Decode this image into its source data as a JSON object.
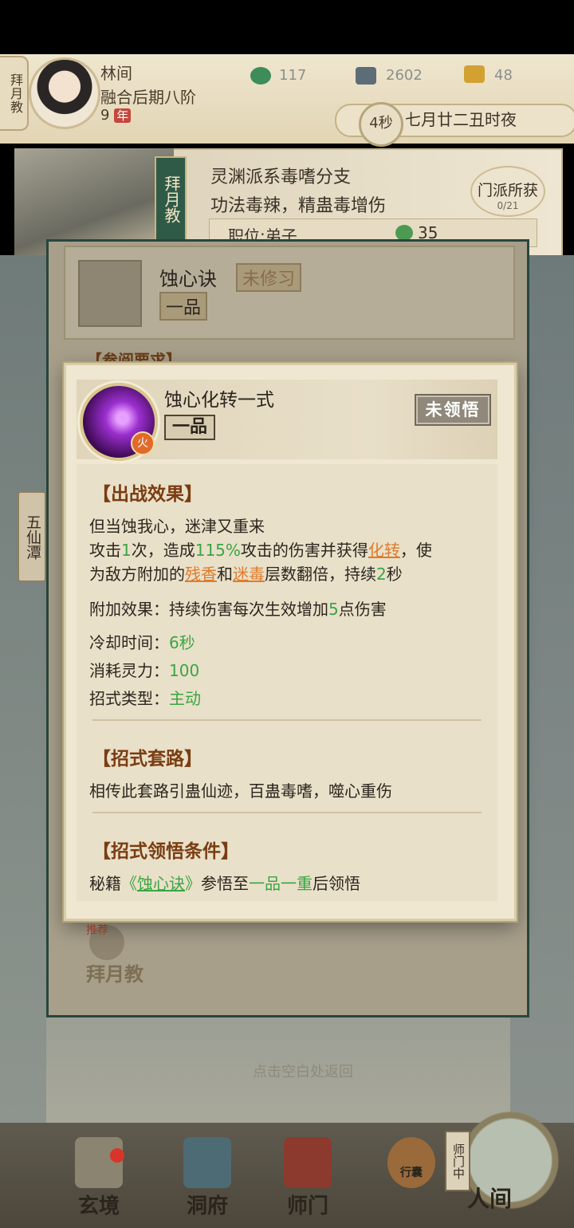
{
  "sect_tab": "拜月教",
  "player": {
    "name": "林间",
    "realm": "融合后期八阶",
    "years_value": "9",
    "years_unit": "年"
  },
  "resources": [
    {
      "icon": "jade-icon",
      "value": "117"
    },
    {
      "icon": "coin-icon",
      "value": "2602"
    },
    {
      "icon": "trophy-icon",
      "value": "48"
    }
  ],
  "time": {
    "countdown": "4秒",
    "label": "七月廿二丑时夜"
  },
  "sect": {
    "flag": "拜月教",
    "line1": "灵渊派系毒嗜分支",
    "line2": "功法毒辣，精蛊毒增伤",
    "position": "职位:弟子",
    "points": "35",
    "menpai_label": "门派所获",
    "menpai_count": "0/21"
  },
  "side_tab": "五仙潭",
  "book": {
    "name": "蚀心诀",
    "status": "未修习",
    "grade": "一品",
    "section_partial": "【参阅要求】"
  },
  "recommend": {
    "tag": "推荐",
    "label": "拜月教"
  },
  "hint": "点击空白处返回",
  "nav": [
    {
      "label": "玄境"
    },
    {
      "label": "洞府"
    },
    {
      "label": "师门"
    },
    {
      "label": "行囊"
    },
    {
      "label": "人间"
    }
  ],
  "nav_side_tab": "师门中",
  "modal": {
    "title": "蚀心化转一式",
    "grade": "一品",
    "element": "火",
    "status": "未领悟",
    "effect": {
      "title": "【出战效果】",
      "quote": "但当蚀我心，迷津又重来",
      "l1_a": "攻击",
      "l1_b": "1",
      "l1_c": "次，造成",
      "l1_d": "115%",
      "l1_e": "攻击的伤害并获得",
      "l1_f": "化转",
      "l1_g": "，使",
      "l2_a": "为敌方附加的",
      "l2_b": "残香",
      "l2_c": "和",
      "l2_d": "迷毒",
      "l2_e": "层数翻倍，持续",
      "l2_f": "2",
      "l2_g": "秒",
      "extra_a": "附加效果：持续伤害每次生效增加",
      "extra_b": "5",
      "extra_c": "点伤害",
      "cd_label": "冷却时间：",
      "cd_value": "6秒",
      "mp_label": "消耗灵力：",
      "mp_value": "100",
      "type_label": "招式类型：",
      "type_value": "主动"
    },
    "route": {
      "title": "【招式套路】",
      "text": "相传此套路引蛊仙迹，百蛊毒嗜，噬心重伤"
    },
    "cond": {
      "title": "【招式领悟条件】",
      "a": "秘籍",
      "b": "《",
      "c": "蚀心诀",
      "d": "》",
      "e": "参悟至",
      "f": "一品一重",
      "g": "后领悟"
    }
  }
}
